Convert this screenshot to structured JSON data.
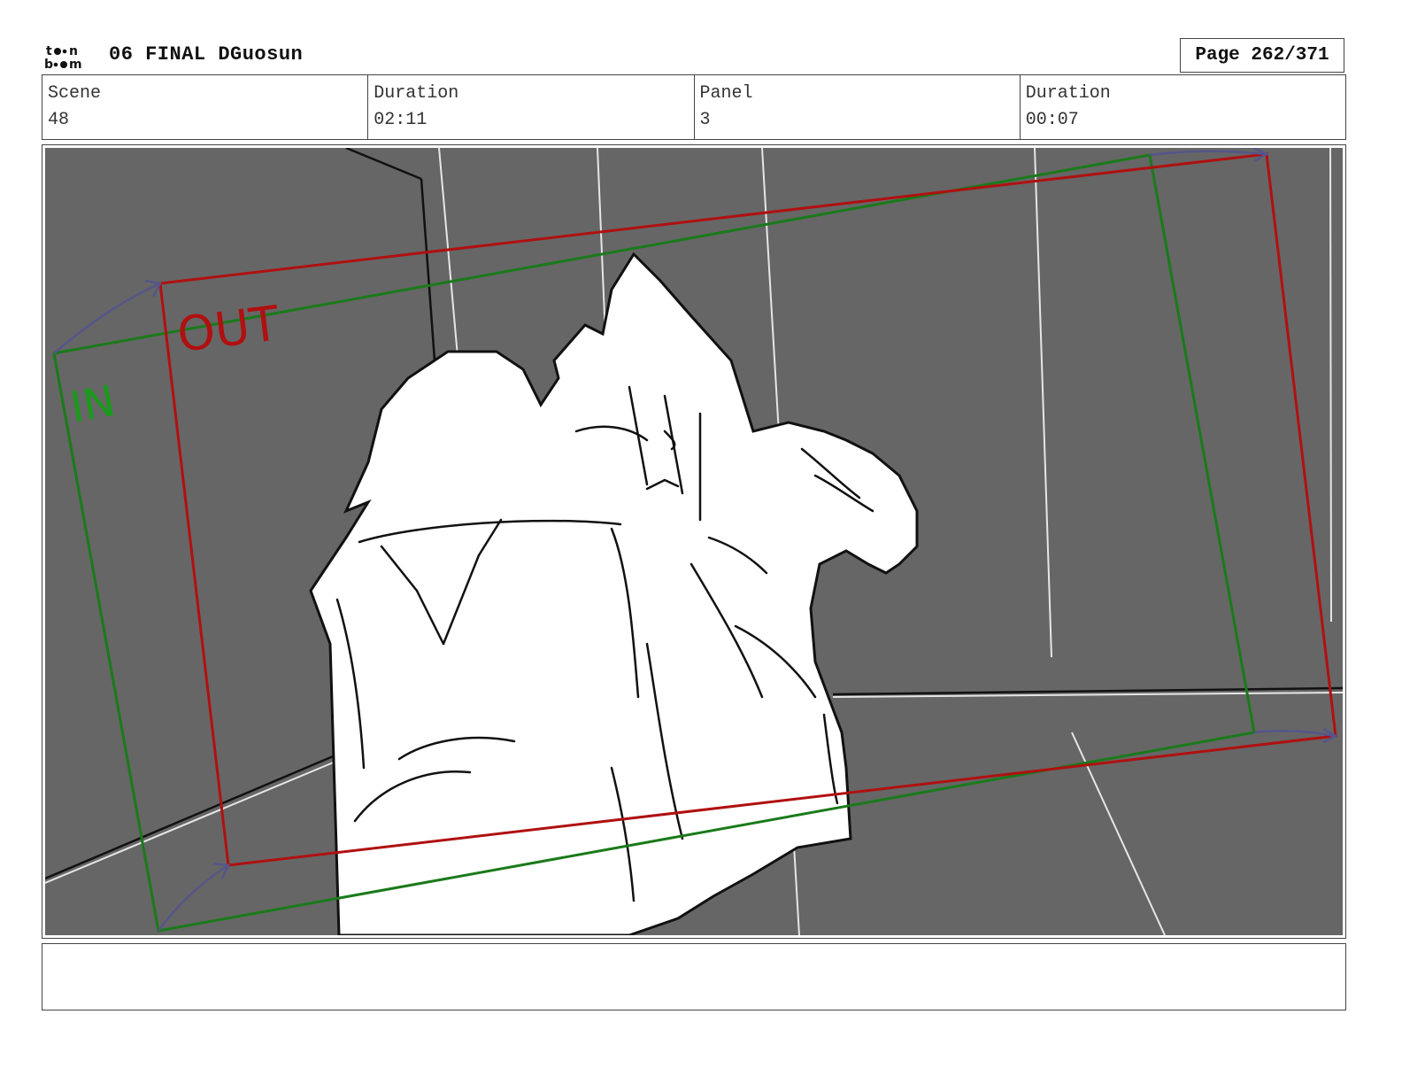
{
  "header": {
    "project_title": "06 FINAL DGuosun",
    "page_label": "Page 262/371",
    "logo_name": "toon boom"
  },
  "info": {
    "scene_label": "Scene",
    "scene_value": "48",
    "scene_duration_label": "Duration",
    "scene_duration_value": "02:11",
    "panel_label": "Panel",
    "panel_value": "3",
    "panel_duration_label": "Duration",
    "panel_duration_value": "00:07"
  },
  "panel": {
    "in_label": "IN",
    "out_label": "OUT",
    "colors": {
      "background": "#666666",
      "in_frame": "#1a7a1a",
      "out_frame": "#b01010",
      "motion_arrow": "#55558a"
    }
  },
  "notes": {
    "text": ""
  }
}
